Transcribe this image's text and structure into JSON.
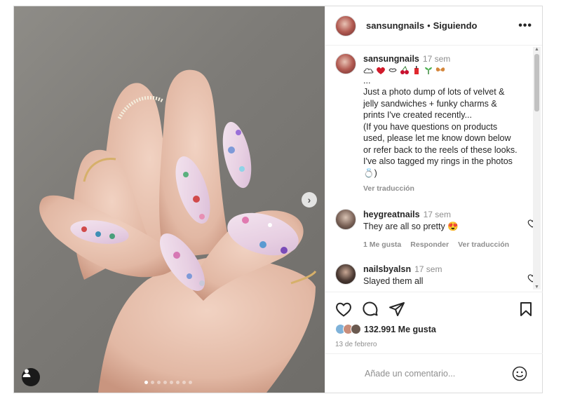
{
  "post": {
    "username": "sansungnails",
    "separator": "•",
    "follow_status": "Siguiendo",
    "more_label": "•••"
  },
  "caption": {
    "username": "sansungnails",
    "time": "17 sem",
    "emojis": [
      "cloud-icon",
      "heart-icon",
      "kiss-icon",
      "cherries-icon",
      "juice-icon",
      "sprout-icon",
      "butterfly-icon"
    ],
    "text": "...\nJust a photo dump of lots of velvet &\njelly sandwiches + funky charms &\nprints I've created recently...\n(If you have questions on products\nused, please let me know down below\nor refer back to the reels of these looks.\nI've also tagged my rings in the photos",
    "ring_emoji": "💍",
    "close_paren": ")",
    "translate": "Ver traducción"
  },
  "comments": [
    {
      "username": "heygreatnails",
      "time": "17 sem",
      "text": "They are all so pretty",
      "emoji": "😍",
      "likes_label": "1 Me gusta",
      "reply_label": "Responder",
      "translate": "Ver traducción"
    },
    {
      "username": "nailsbyalsn",
      "time": "17 sem",
      "text": "Slayed them all"
    }
  ],
  "actions": {
    "likes_count": "132.991 Me gusta",
    "date": "13 de febrero"
  },
  "add_comment": {
    "placeholder": "Añade un comentario..."
  },
  "carousel": {
    "total_slides": 8,
    "active_index": 0,
    "next_label": "›"
  },
  "colors": {
    "text": "#262626",
    "secondary": "#8e8e8e",
    "border": "#efefef"
  }
}
